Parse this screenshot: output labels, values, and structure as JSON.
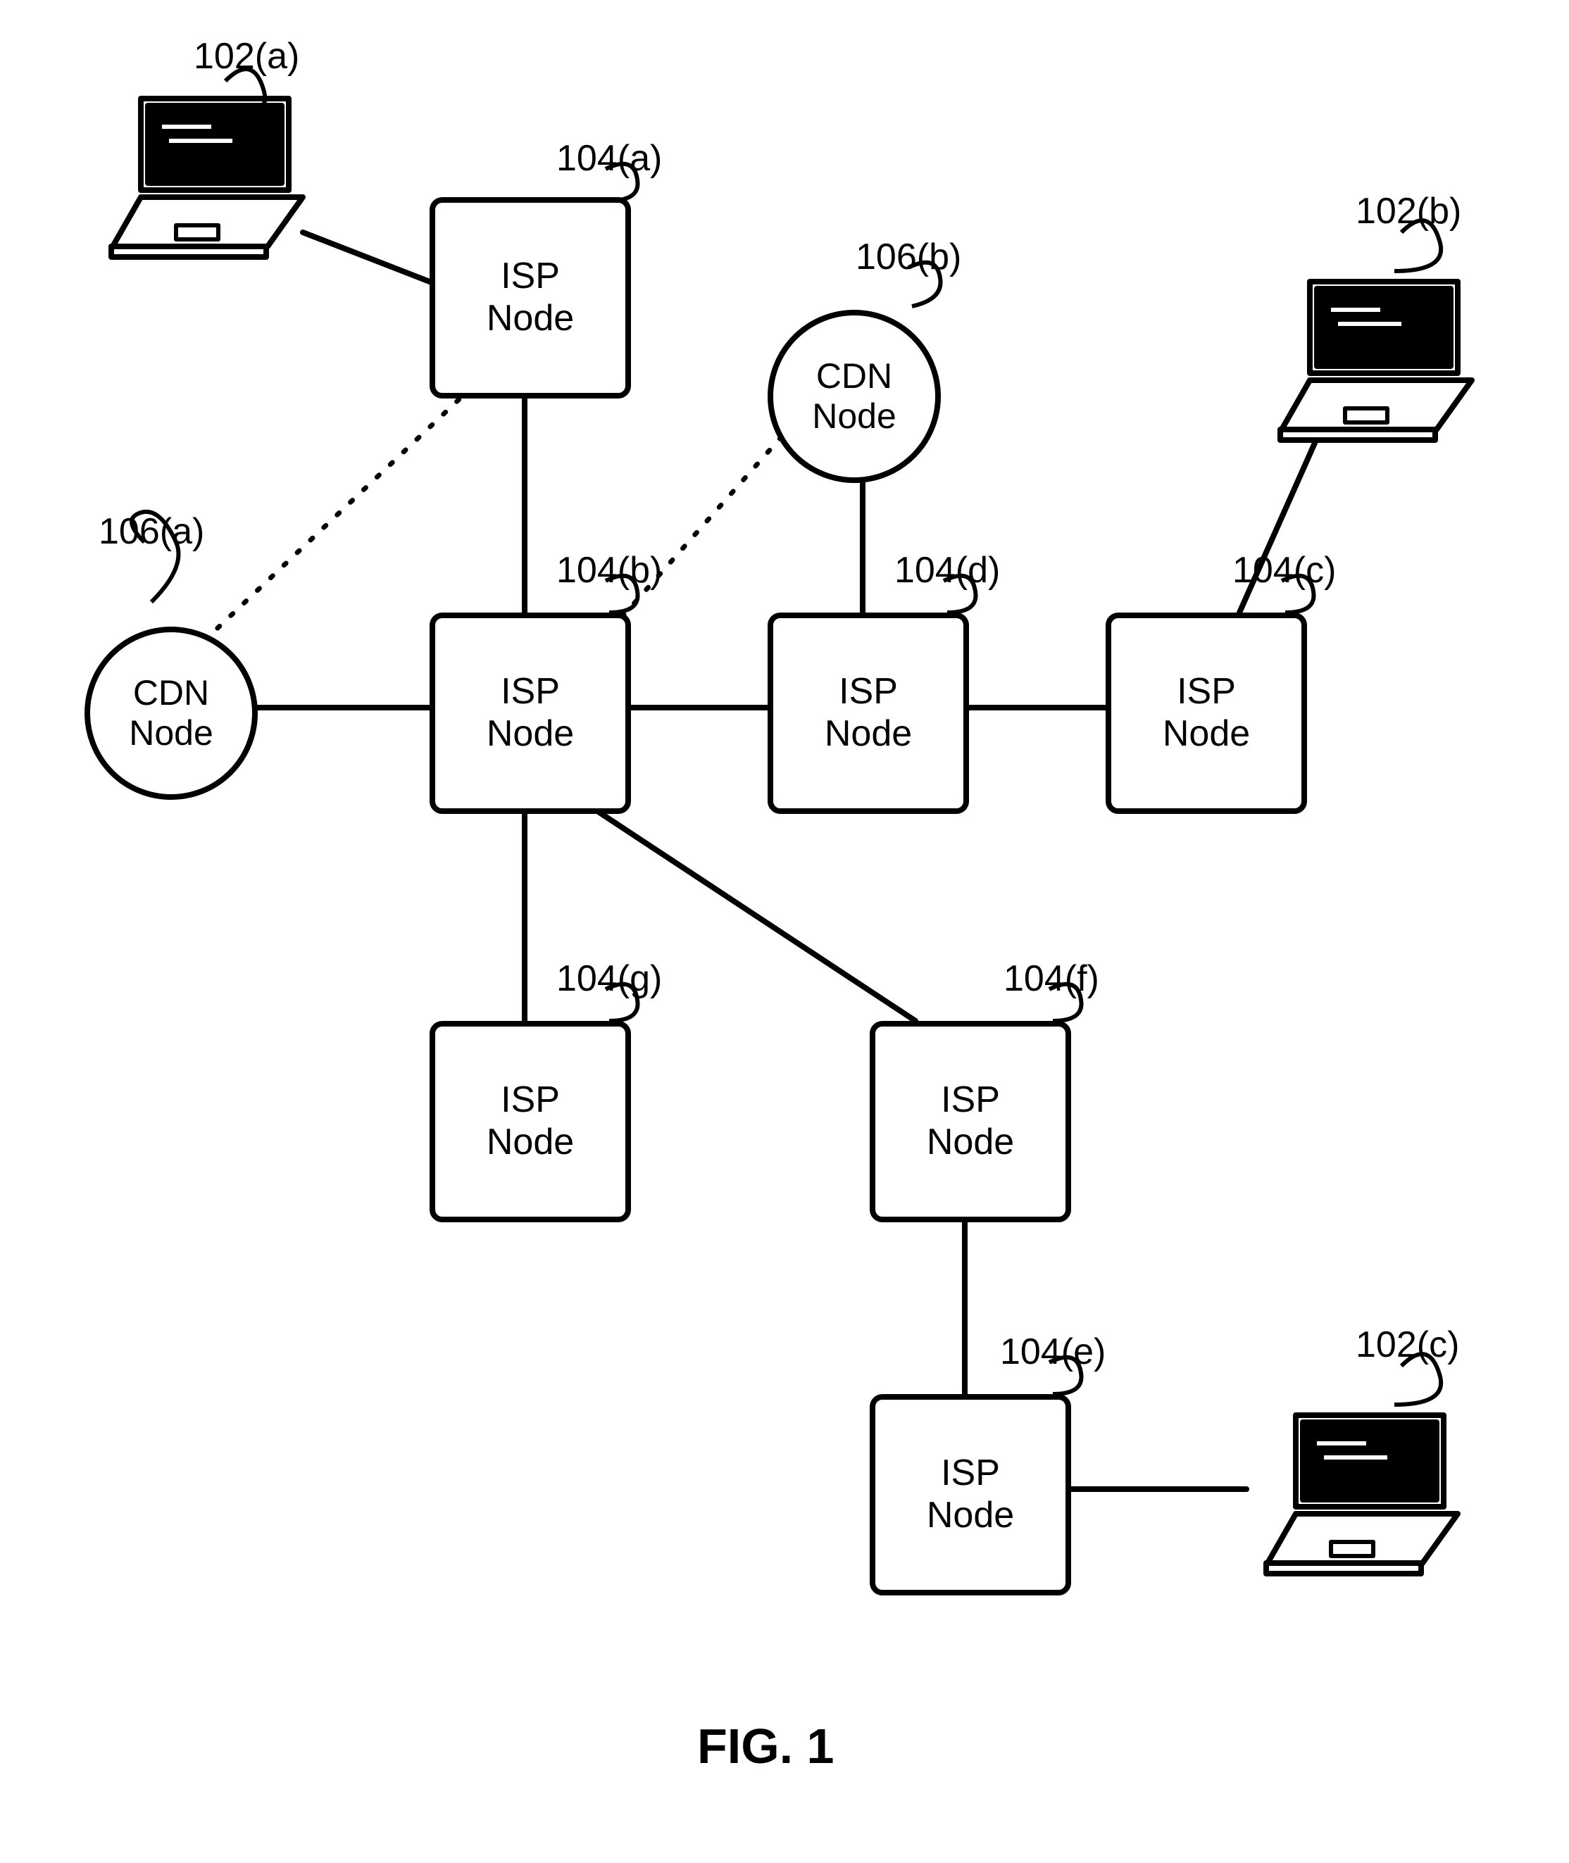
{
  "figure_caption": "FIG. 1",
  "nodes": {
    "isp_a": "ISP\nNode",
    "isp_b": "ISP\nNode",
    "isp_c": "ISP\nNode",
    "isp_d": "ISP\nNode",
    "isp_e": "ISP\nNode",
    "isp_f": "ISP\nNode",
    "isp_g": "ISP\nNode",
    "cdn_a": "CDN\nNode",
    "cdn_b": "CDN\nNode"
  },
  "labels": {
    "l102a": "102(a)",
    "l102b": "102(b)",
    "l102c": "102(c)",
    "l104a": "104(a)",
    "l104b": "104(b)",
    "l104c": "104(c)",
    "l104d": "104(d)",
    "l104e": "104(e)",
    "l104f": "104(f)",
    "l104g": "104(g)",
    "l106a": "106(a)",
    "l106b": "106(b)"
  }
}
